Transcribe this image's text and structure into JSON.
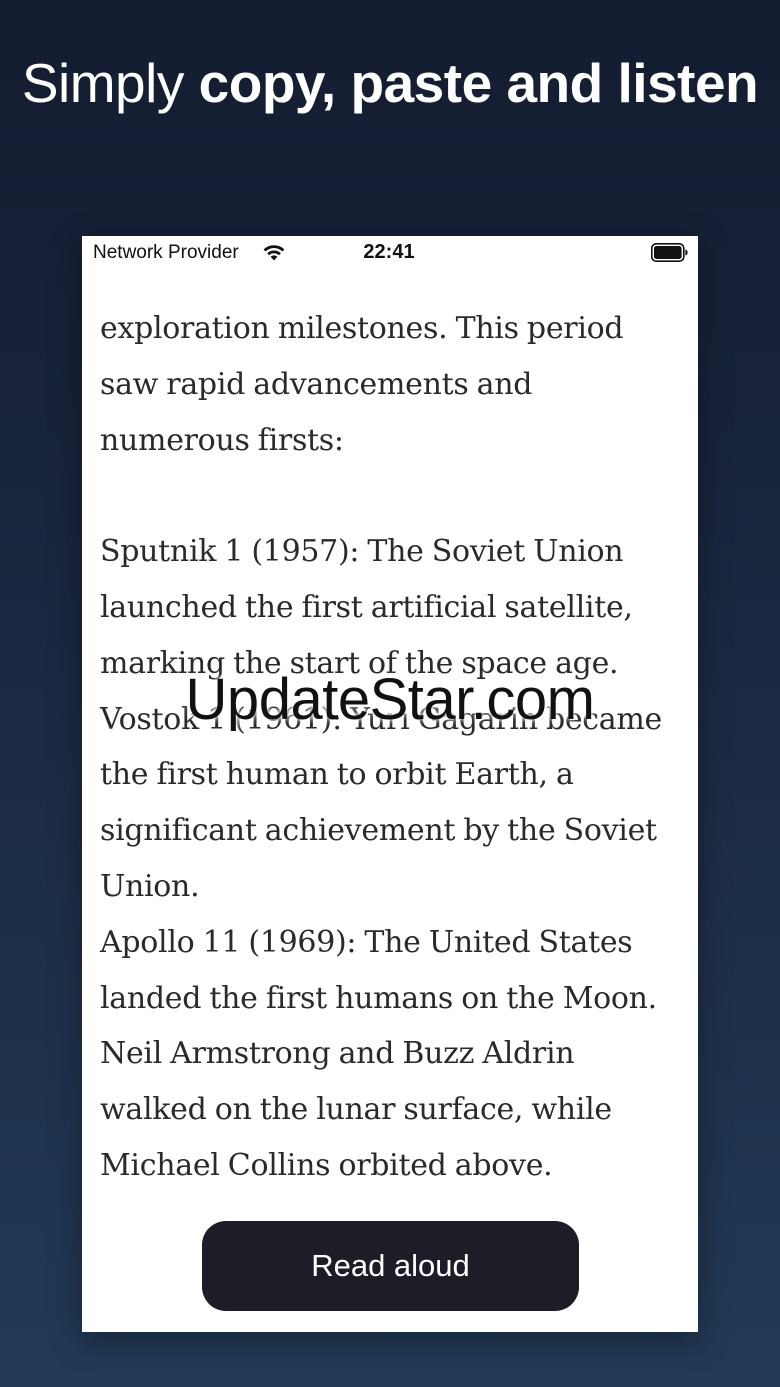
{
  "headline": {
    "light": "Simply ",
    "bold": "copy, paste and listen"
  },
  "status_bar": {
    "carrier": "Network Provider",
    "time": "22:41",
    "wifi_icon": "wifi-icon",
    "battery_icon": "battery-icon"
  },
  "content": {
    "paragraph_1": "exploration milestones. This period saw rapid advancements and numerous firsts:",
    "item_1": "Sputnik 1 (1957): The Soviet Union launched the first artificial satellite, marking the start of the space age.",
    "item_2": "Vostok 1 (1961): Yuri Gagarin became the first human to orbit Earth, a significant achievement by the Soviet Union.",
    "item_3": "Apollo 11 (1969): The United States landed the first humans on the Moon. Neil Armstrong and Buzz Aldrin walked on the lunar surface, while Michael Collins orbited above."
  },
  "button": {
    "label": "Read aloud"
  },
  "watermark": "UpdateStar.com",
  "colors": {
    "background_top": "#141c30",
    "background_bottom": "#223a55",
    "button": "#1c1d27",
    "text": "#2a2a2a"
  }
}
